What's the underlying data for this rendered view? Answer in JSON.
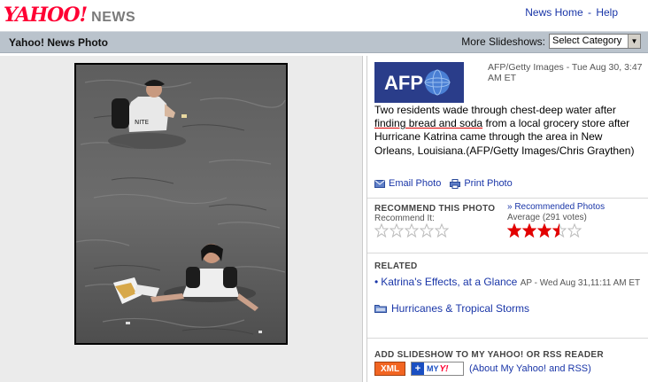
{
  "header": {
    "logo_yahoo": "YAHOO!",
    "logo_news": "NEWS",
    "links": [
      "News Home",
      "Help"
    ],
    "link_separator": "-"
  },
  "titlebar": {
    "title": "Yahoo! News Photo",
    "more_label": "More Slideshows:",
    "select_value": "Select Category"
  },
  "photo": {
    "credit": "AFP/Getty Images - Tue Aug 30, 3:47 AM ET",
    "caption_before": "Two residents wade through chest-deep water after ",
    "caption_link": "finding bread and soda",
    "caption_after": " from a local grocery store after Hurricane Katrina came through the area in New Orleans, Louisiana.(AFP/Getty Images/Chris Graythen)",
    "source_logo_text": "AFP"
  },
  "actions": {
    "email": "Email Photo",
    "print": "Print Photo"
  },
  "recommend": {
    "heading": "RECOMMEND THIS PHOTO",
    "sub": "Recommend It:",
    "link": "» Recommended Photos",
    "average": "Average (291 votes)",
    "rating": 3.5,
    "max": 5
  },
  "related": {
    "heading": "RELATED",
    "item1_title": "Katrina's Effects, at a Glance",
    "item1_meta": "AP - Wed Aug 31,11:11 AM ET",
    "item2_title": "Hurricanes & Tropical Storms"
  },
  "add": {
    "heading": "ADD SLIDESHOW TO MY YAHOO! OR RSS READER",
    "xml": "XML",
    "my_text": "MY",
    "my_y": "Y!",
    "about": "(About My Yahoo! and RSS)"
  },
  "colors": {
    "link": "#1a36a8",
    "yahoo_red": "#ff0033",
    "titlebar": "#bac3cc",
    "star_on": "#e30000",
    "star_off": "#bbbbbb",
    "xml_orange": "#f26522"
  }
}
